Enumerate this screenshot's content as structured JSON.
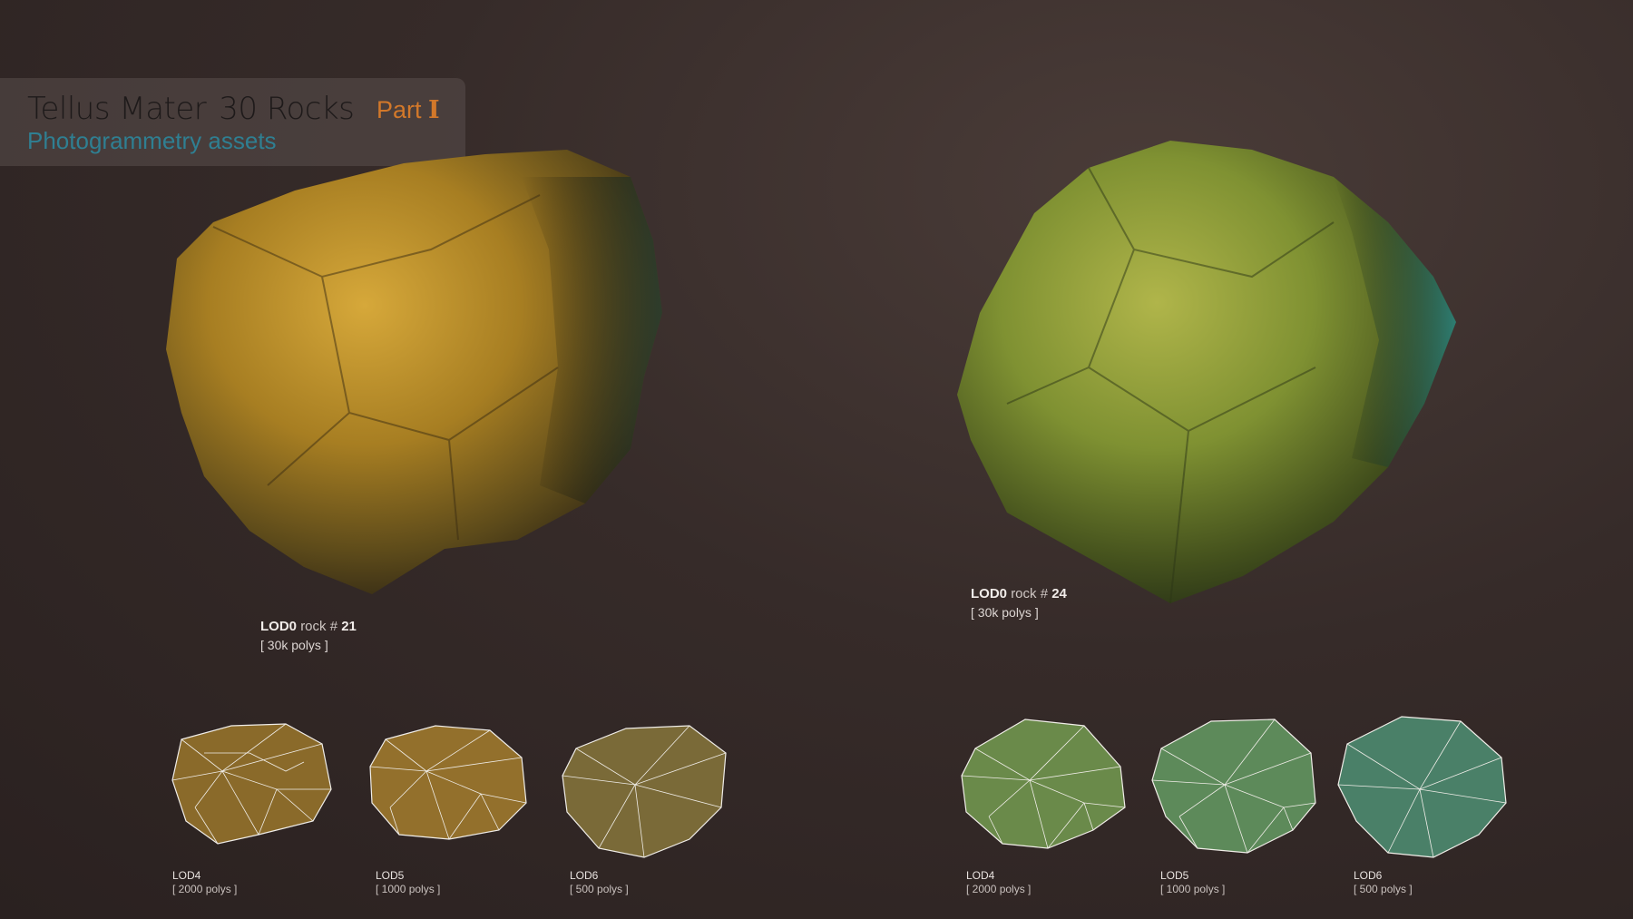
{
  "header": {
    "title_left": "Tellus Mater",
    "title_right": "30 Rocks",
    "part_label": "Part",
    "part_numeral": "I",
    "subtitle": "Photogrammetry assets",
    "colors": {
      "title": "#1e1a1a",
      "part": "#d2782a",
      "subtitle": "#2f7f92"
    }
  },
  "rock_left": {
    "lod_label": "LOD0",
    "rock_label": "rock #",
    "rock_number": "21",
    "polys": "[ 30k polys ]",
    "color": "#b08a2a",
    "lods": [
      {
        "label": "LOD4",
        "polys": "[ 2000 polys ]"
      },
      {
        "label": "LOD5",
        "polys": "[ 1000 polys ]"
      },
      {
        "label": "LOD6",
        "polys": "[ 500 polys ]"
      }
    ]
  },
  "rock_right": {
    "lod_label": "LOD0",
    "rock_label": "rock #",
    "rock_number": "24",
    "polys": "[ 30k polys ]",
    "color": "#8e9f3a",
    "lods": [
      {
        "label": "LOD4",
        "polys": "[ 2000 polys ]"
      },
      {
        "label": "LOD5",
        "polys": "[ 1000 polys ]"
      },
      {
        "label": "LOD6",
        "polys": "[ 500 polys ]"
      }
    ]
  }
}
